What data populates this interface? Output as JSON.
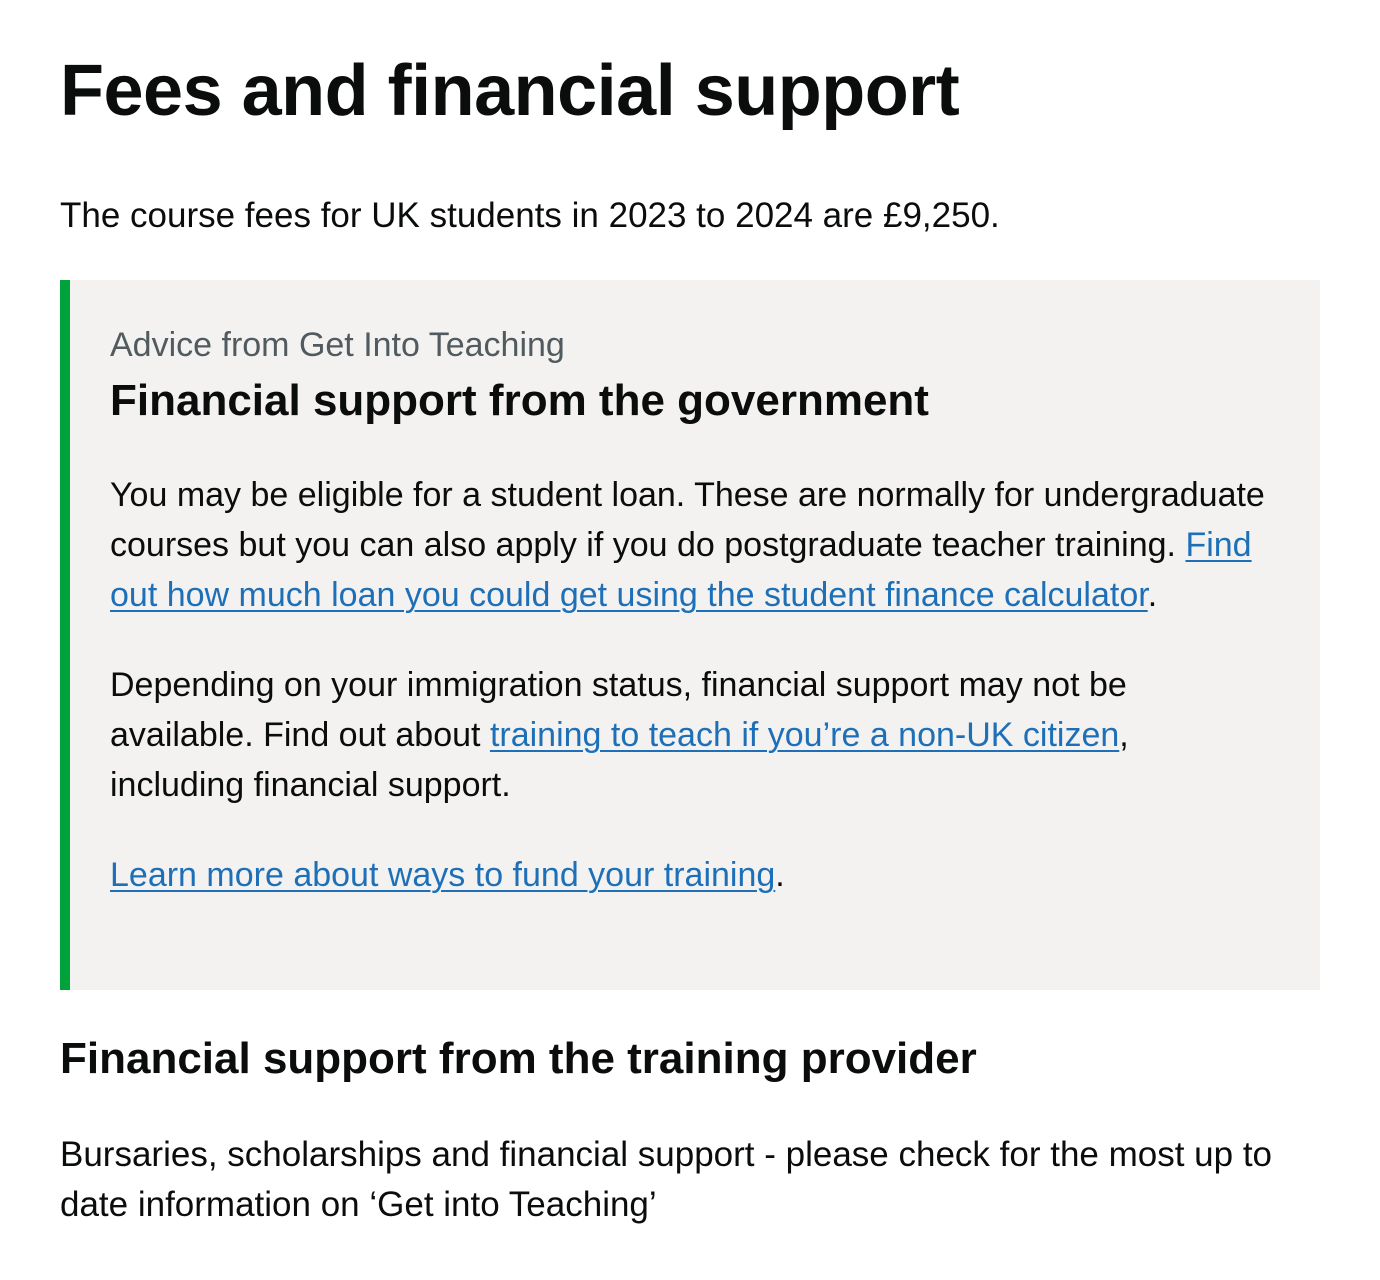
{
  "page": {
    "title": "Fees and financial support",
    "fees_text": "The course fees for UK students in 2023 to 2024 are £9,250."
  },
  "advice": {
    "caption": "Advice from Get Into Teaching",
    "heading": "Financial support from the government",
    "para1_text": "You may be eligible for a student loan. These are normally for undergraduate courses but you can also apply if you do postgraduate teacher training. ",
    "para1_link": "Find out how much loan you could get using the student finance calculator",
    "para1_after": ".",
    "para2_text": "Depending on your immigration status, financial support may not be available. Find out about ",
    "para2_link": "training to teach if you’re a non-UK citizen",
    "para2_after": ", including financial support.",
    "para3_link": "Learn more about ways to fund your training",
    "para3_after": "."
  },
  "provider": {
    "heading": "Financial support from the training provider",
    "text": "Bursaries, scholarships and financial support - please check for the most up to date information on ‘Get into Teaching’"
  },
  "colors": {
    "link": "#1d70b8",
    "accent_border": "#00a33b",
    "panel_background": "#f3f2f1",
    "caption_text": "#505a5f",
    "body_text": "#0b0c0c"
  }
}
